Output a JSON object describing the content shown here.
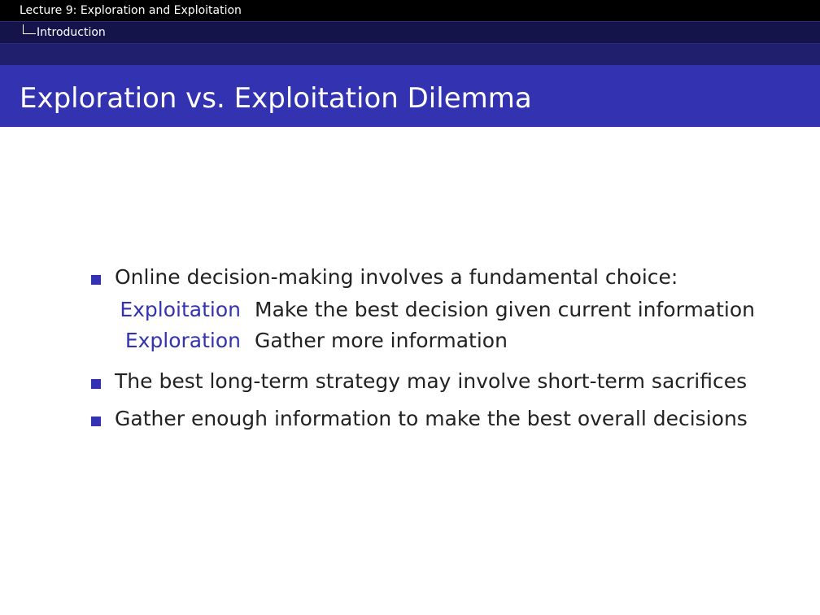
{
  "header": {
    "lecture_title": "Lecture 9: Exploration and Exploitation",
    "section_title": "Introduction"
  },
  "frame": {
    "title": "Exploration vs. Exploitation Dilemma"
  },
  "content": {
    "bullets": [
      "Online decision-making involves a fundamental choice:",
      "The best long-term strategy may involve short-term sacrifices",
      "Gather enough information to make the best overall decisions"
    ],
    "descriptions": [
      {
        "term": "Exploitation",
        "definition": "Make the best decision given current information"
      },
      {
        "term": "Exploration",
        "definition": "Gather more information"
      }
    ]
  },
  "colors": {
    "title_bar": "#3333b2",
    "header_black": "#000000",
    "header_dark_blue": "#14144a",
    "header_mid_blue": "#1f1f6e",
    "term_color": "#3333b2",
    "text_color": "#222222"
  }
}
